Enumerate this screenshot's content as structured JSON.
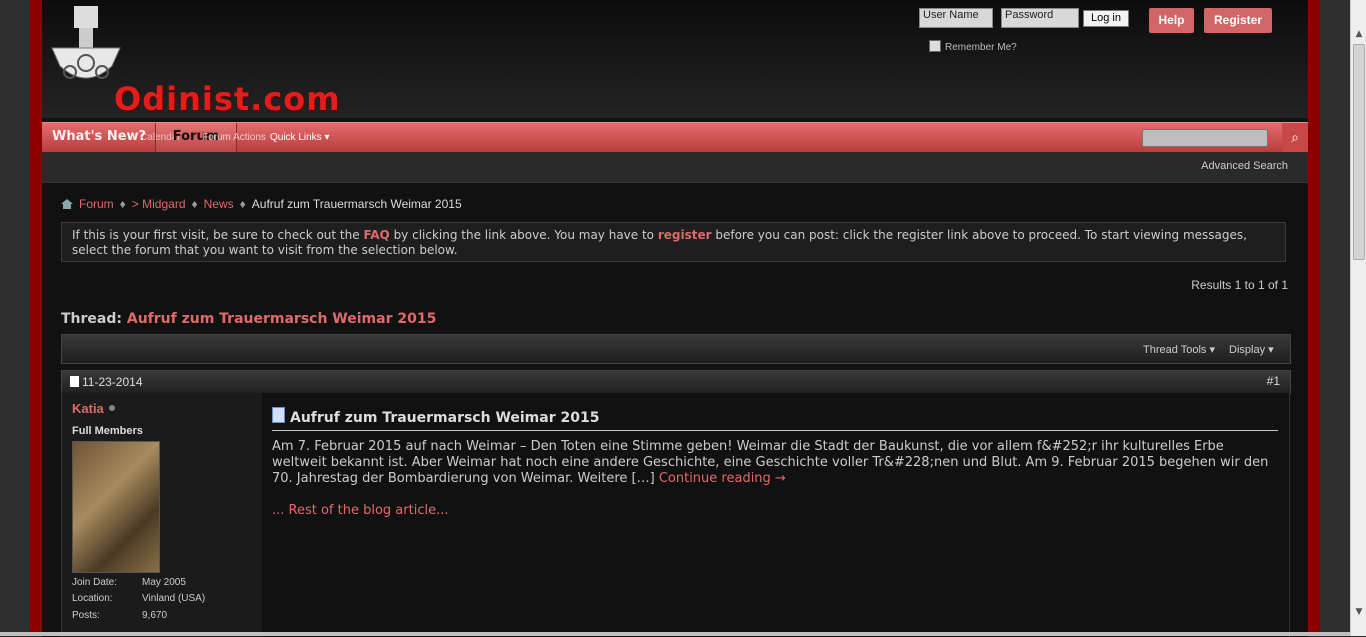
{
  "header": {
    "site_name": "Odinist.com",
    "login": {
      "user_placeholder": "User Name",
      "pass_placeholder": "Password",
      "login_label": "Log in",
      "remember_label": "Remember Me?"
    },
    "help_label": "Help",
    "register_label": "Register"
  },
  "nav": {
    "whats_new": "What's New?",
    "forum": "Forum",
    "sub_items": [
      "Calendar",
      "Forum Actions",
      "Quick Links"
    ],
    "advanced_search": "Advanced Search"
  },
  "breadcrumb": {
    "forum": "Forum",
    "midgard": "> Midgard",
    "news": "News",
    "current": "Aufruf zum Trauermarsch Weimar 2015"
  },
  "notice": {
    "part1": "If this is your first visit, be sure to check out the ",
    "faq": "FAQ",
    "part2": " by clicking the link above. You may have to ",
    "register": "register",
    "part3": " before you can post: click the register link above to proceed. To start viewing messages, select the forum that you want to visit from the selection below."
  },
  "results": "Results 1 to 1 of 1",
  "thread": {
    "label": "Thread:",
    "title": "Aufruf zum Trauermarsch Weimar 2015",
    "tools": "Thread Tools",
    "display": "Display"
  },
  "post": {
    "date": "11-23-2014",
    "number": "#1",
    "user": {
      "name": "Katia",
      "title": "Full Members",
      "join_label": "Join Date:",
      "join": "May 2005",
      "loc_label": "Location:",
      "location": "Vinland (USA)",
      "posts_label": "Posts:",
      "posts": "9,670"
    },
    "title": "Aufruf zum Trauermarsch Weimar 2015",
    "body": "Am 7. Februar 2015 auf nach Weimar – Den Toten eine Stimme geben! Weimar die Stadt der Baukunst, die vor allem f&#252;r ihr kulturelles Erbe weltweit bekannt ist. Aber Weimar hat noch eine andere Geschichte, eine Geschichte voller Tr&#228;nen und Blut. Am 9. Februar 2015 begehen wir den 70. Jahrestag der Bombardierung von Weimar. Weitere […] ",
    "continue": "Continue reading →",
    "more": "... Rest of the blog article..."
  },
  "colors": {
    "accent": "#e06a6a",
    "nav_red": "#c84747",
    "rail": "#8c0000"
  }
}
